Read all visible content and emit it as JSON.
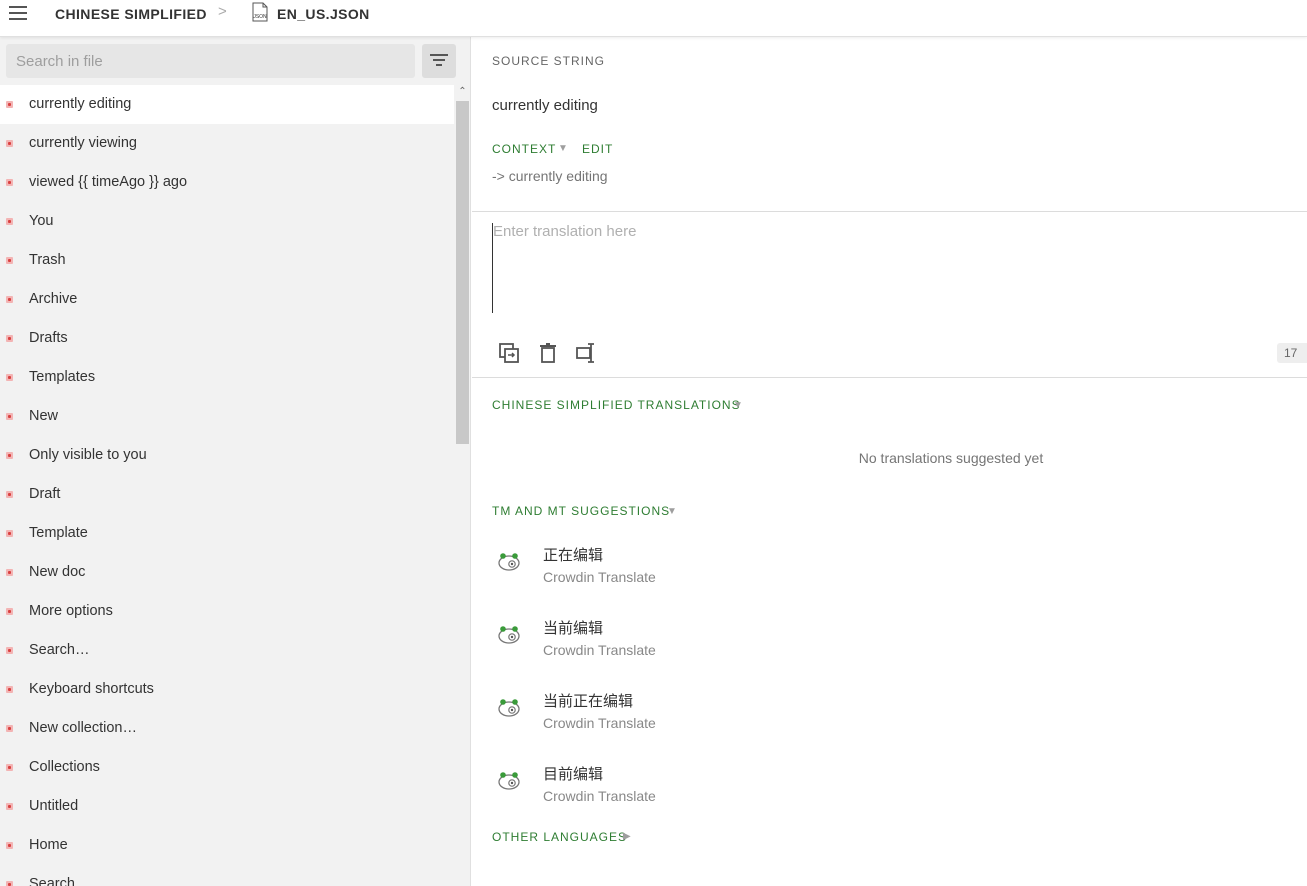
{
  "header": {
    "language": "CHINESE SIMPLIFIED",
    "separator": ">",
    "file_name": "EN_US.JSON",
    "file_icon_label": "JSON"
  },
  "sidebar": {
    "search_placeholder": "Search in file",
    "strings": [
      "currently editing",
      "currently viewing",
      "viewed {{ timeAgo }} ago",
      "You",
      "Trash",
      "Archive",
      "Drafts",
      "Templates",
      "New",
      "Only visible to you",
      "Draft",
      "Template",
      "New doc",
      "More options",
      "Search…",
      "Keyboard shortcuts",
      "New collection…",
      "Collections",
      "Untitled",
      "Home",
      "Search"
    ],
    "active_index": 0
  },
  "editor": {
    "source_label": "SOURCE STRING",
    "source_text": "currently editing",
    "context_label": "CONTEXT",
    "edit_label": "EDIT",
    "context_text": "-> currently editing",
    "translation_placeholder": "Enter translation here",
    "char_count": "17",
    "translations_label": "CHINESE SIMPLIFIED TRANSLATIONS",
    "no_translations": "No translations suggested yet",
    "suggestions_label": "TM AND MT SUGGESTIONS",
    "suggestions": [
      {
        "text": "正在编辑",
        "source": "Crowdin Translate"
      },
      {
        "text": "当前编辑",
        "source": "Crowdin Translate"
      },
      {
        "text": "当前正在编辑",
        "source": "Crowdin Translate"
      },
      {
        "text": "目前编辑",
        "source": "Crowdin Translate"
      }
    ],
    "other_languages_label": "OTHER LANGUAGES"
  },
  "colors": {
    "accent_green": "#2e7d32",
    "status_untranslated": "#d94141"
  },
  "icons": {
    "menu": "hamburger-icon",
    "filter": "filter-icon",
    "copy_source": "copy-source-icon",
    "clear": "trash-icon",
    "split": "split-icon",
    "suggestion": "crowdin-translate-icon"
  }
}
